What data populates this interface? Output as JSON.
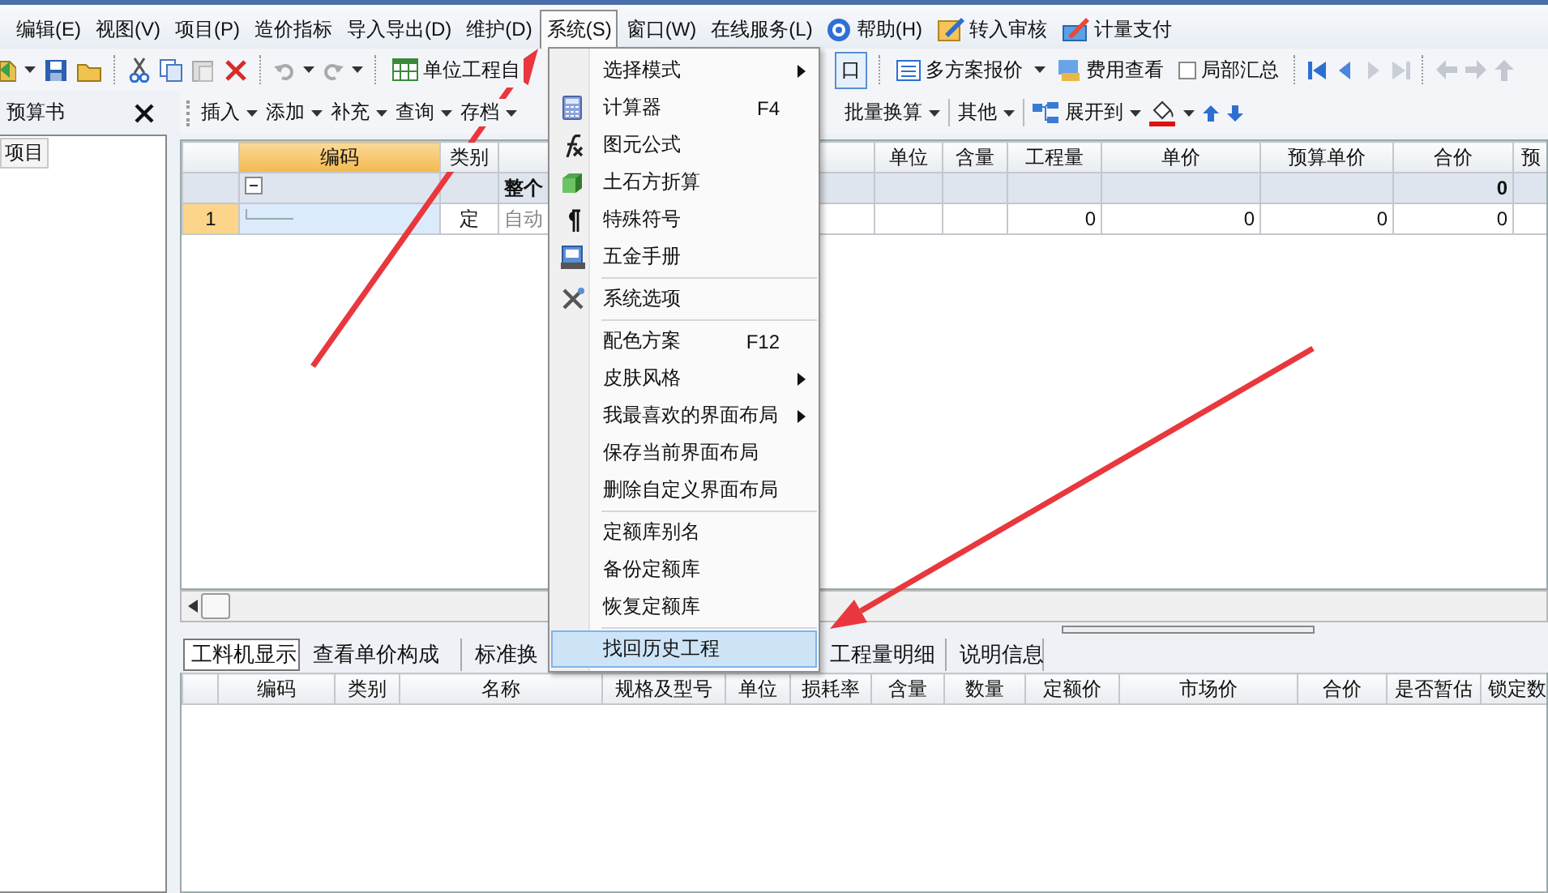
{
  "menubar": [
    {
      "label": "编辑(E)",
      "open": false,
      "kind": "text"
    },
    {
      "label": "视图(V)",
      "open": false,
      "kind": "text"
    },
    {
      "label": "项目(P)",
      "open": false,
      "kind": "text"
    },
    {
      "label": "造价指标",
      "open": false,
      "kind": "text"
    },
    {
      "label": "导入导出(D)",
      "open": false,
      "kind": "text"
    },
    {
      "label": "维护(D)",
      "open": false,
      "kind": "text"
    },
    {
      "label": "系统(S)",
      "open": true,
      "kind": "text"
    },
    {
      "label": "窗口(W)",
      "open": false,
      "kind": "text"
    },
    {
      "label": "在线服务(L)",
      "open": false,
      "kind": "text"
    },
    {
      "label": "帮助(H)",
      "open": false,
      "kind": "help"
    },
    {
      "label": "转入审核",
      "open": false,
      "kind": "audit"
    },
    {
      "label": "计量支付",
      "open": false,
      "kind": "payment"
    }
  ],
  "toolbar": {
    "unit_project": "单位工程自",
    "window_button": {
      "label": "口",
      "selected": true
    },
    "schemes": "多方案报价",
    "cost_view": "费用查看",
    "partial_summary": {
      "label": "局部汇总",
      "checked": false
    }
  },
  "budget_panel": {
    "title": "预算书",
    "tree": [
      {
        "label": "项目",
        "selected": true
      }
    ]
  },
  "edit_toolbar": {
    "left": [
      {
        "label": "插入"
      },
      {
        "label": "添加"
      },
      {
        "label": "补充"
      },
      {
        "label": "查询"
      },
      {
        "label": "存档"
      }
    ],
    "right": [
      {
        "label": "批量换算"
      },
      {
        "label": "其他"
      },
      {
        "label": "展开到"
      }
    ]
  },
  "grid": {
    "columns": [
      {
        "label": "编码",
        "selected": true
      },
      {
        "label": "类别",
        "selected": false
      },
      {
        "label": "单位",
        "selected": false
      },
      {
        "label": "含量",
        "selected": false
      },
      {
        "label": "工程量",
        "selected": false
      },
      {
        "label": "单价",
        "selected": false
      },
      {
        "label": "预算单价",
        "selected": false
      },
      {
        "label": "合价",
        "selected": false
      },
      {
        "label": "预",
        "selected": false
      }
    ],
    "rows": [
      {
        "kind": "group",
        "expanded": true,
        "title": "整个",
        "total": "0"
      },
      {
        "kind": "item",
        "selected": true,
        "number": "1",
        "type": "定",
        "name": "自动",
        "quantity": "0",
        "unit_price": "0",
        "budget_unit_price": "0",
        "total": "0"
      }
    ]
  },
  "detail_tabs": [
    {
      "label": "工料机显示",
      "selected": true
    },
    {
      "label": "查看单价构成",
      "selected": false
    },
    {
      "label": "标准换",
      "selected": false
    },
    {
      "label": "工程量明细",
      "selected": false
    },
    {
      "label": "说明信息",
      "selected": false
    }
  ],
  "detail_columns": [
    "编码",
    "类别",
    "名称",
    "规格及型号",
    "单位",
    "损耗率",
    "含量",
    "数量",
    "定额价",
    "市场价",
    "合价",
    "是否暂估",
    "锁定数"
  ],
  "system_menu": {
    "groups": [
      [
        {
          "label": "选择模式",
          "submenu": true
        },
        {
          "label": "计算器",
          "shortcut": "F4"
        },
        {
          "label": "图元公式"
        },
        {
          "label": "土石方折算"
        },
        {
          "label": "特殊符号"
        },
        {
          "label": "五金手册"
        }
      ],
      [
        {
          "label": "系统选项"
        }
      ],
      [
        {
          "label": "配色方案",
          "shortcut": "F12"
        },
        {
          "label": "皮肤风格",
          "submenu": true
        },
        {
          "label": "我最喜欢的界面布局",
          "submenu": true
        },
        {
          "label": "保存当前界面布局"
        },
        {
          "label": "删除自定义界面布局"
        }
      ],
      [
        {
          "label": "定额库别名"
        },
        {
          "label": "备份定额库"
        },
        {
          "label": "恢复定额库"
        }
      ],
      [
        {
          "label": "找回历史工程",
          "selected": true
        }
      ]
    ]
  }
}
